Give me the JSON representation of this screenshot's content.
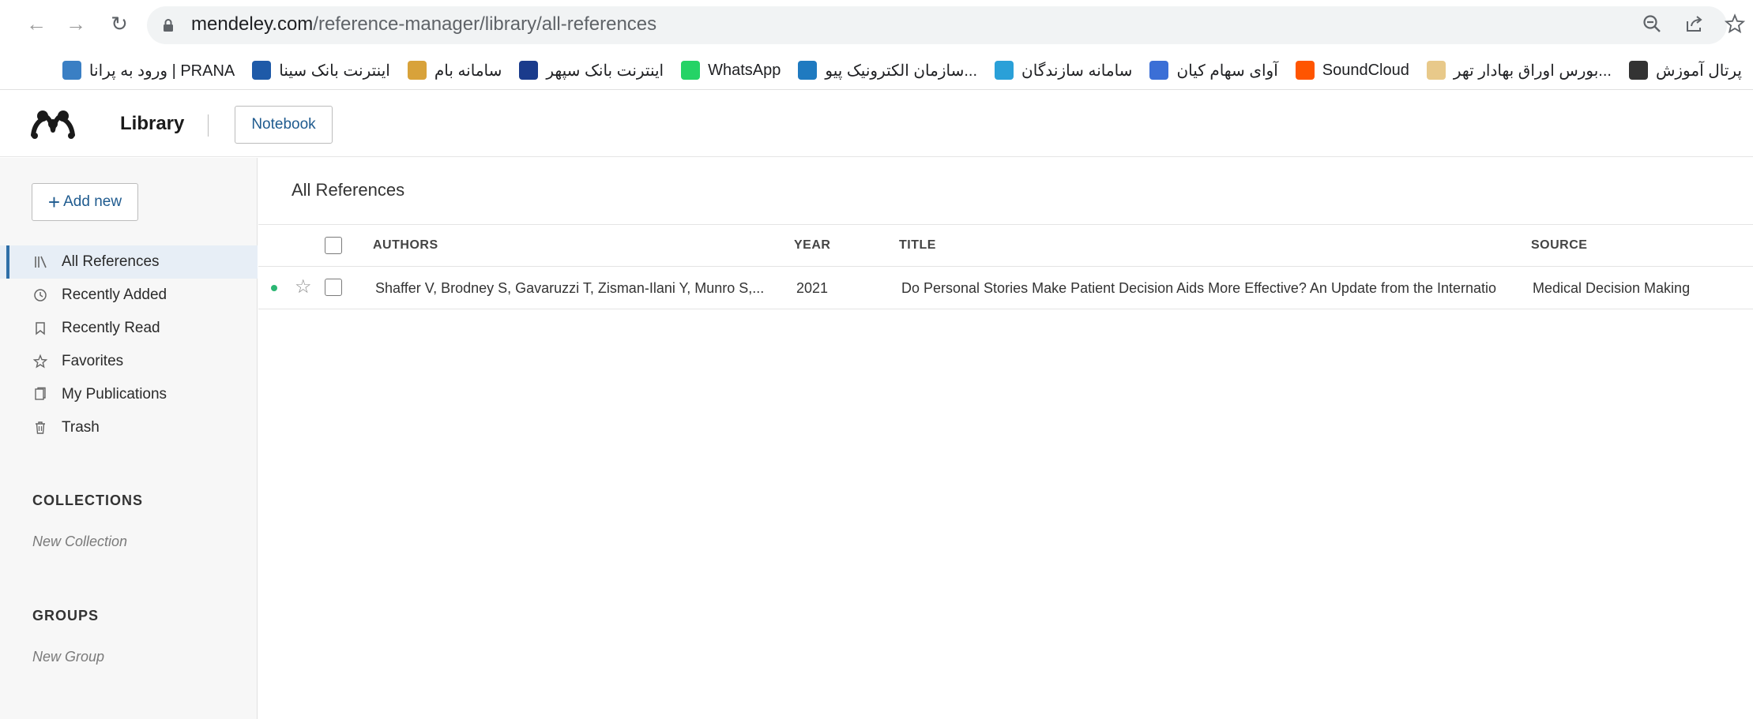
{
  "browser": {
    "url_domain": "mendeley.com",
    "url_path": "/reference-manager/library/all-references",
    "bookmarks": [
      {
        "label": "پرتال آموزش",
        "color": "#333333"
      },
      {
        "label": "بورس اوراق بهادار تهر...",
        "color": "#e8c98a"
      },
      {
        "label": "SoundCloud",
        "color": "#ff5500"
      },
      {
        "label": "آوای سهام کیان",
        "color": "#3b6fd6"
      },
      {
        "label": "سامانه سازندگان",
        "color": "#2aa0d8"
      },
      {
        "label": "سازمان الکترونیک پیو...",
        "color": "#1f7ac0"
      },
      {
        "label": "WhatsApp",
        "color": "#25d366"
      },
      {
        "label": "اینترنت بانک سپهر",
        "color": "#1a3b8c"
      },
      {
        "label": "سامانه بام",
        "color": "#d8a23a"
      },
      {
        "label": "اینترنت بانک سینا",
        "color": "#1e5aa8"
      },
      {
        "label": "ورود به پرانا | PRANA",
        "color": "#3a7fc4"
      }
    ]
  },
  "header": {
    "title": "Library",
    "notebook_label": "Notebook"
  },
  "sidebar": {
    "add_new_label": "Add new",
    "items": [
      {
        "label": "All References",
        "icon": "library-icon"
      },
      {
        "label": "Recently Added",
        "icon": "clock-icon"
      },
      {
        "label": "Recently Read",
        "icon": "bookmark-icon"
      },
      {
        "label": "Favorites",
        "icon": "star-icon"
      },
      {
        "label": "My Publications",
        "icon": "publications-icon"
      },
      {
        "label": "Trash",
        "icon": "trash-icon"
      }
    ],
    "collections_heading": "COLLECTIONS",
    "new_collection": "New Collection",
    "groups_heading": "GROUPS",
    "new_group": "New Group"
  },
  "main": {
    "title": "All References",
    "columns": {
      "authors": "AUTHORS",
      "year": "YEAR",
      "title": "TITLE",
      "source": "SOURCE"
    },
    "rows": [
      {
        "authors": "Shaffer V, Brodney S, Gavaruzzi T, Zisman-Ilani Y, Munro S,...",
        "year": "2021",
        "title": "Do Personal Stories Make Patient Decision Aids More Effective? An Update from the Internatio",
        "source": "Medical Decision Making"
      }
    ]
  }
}
